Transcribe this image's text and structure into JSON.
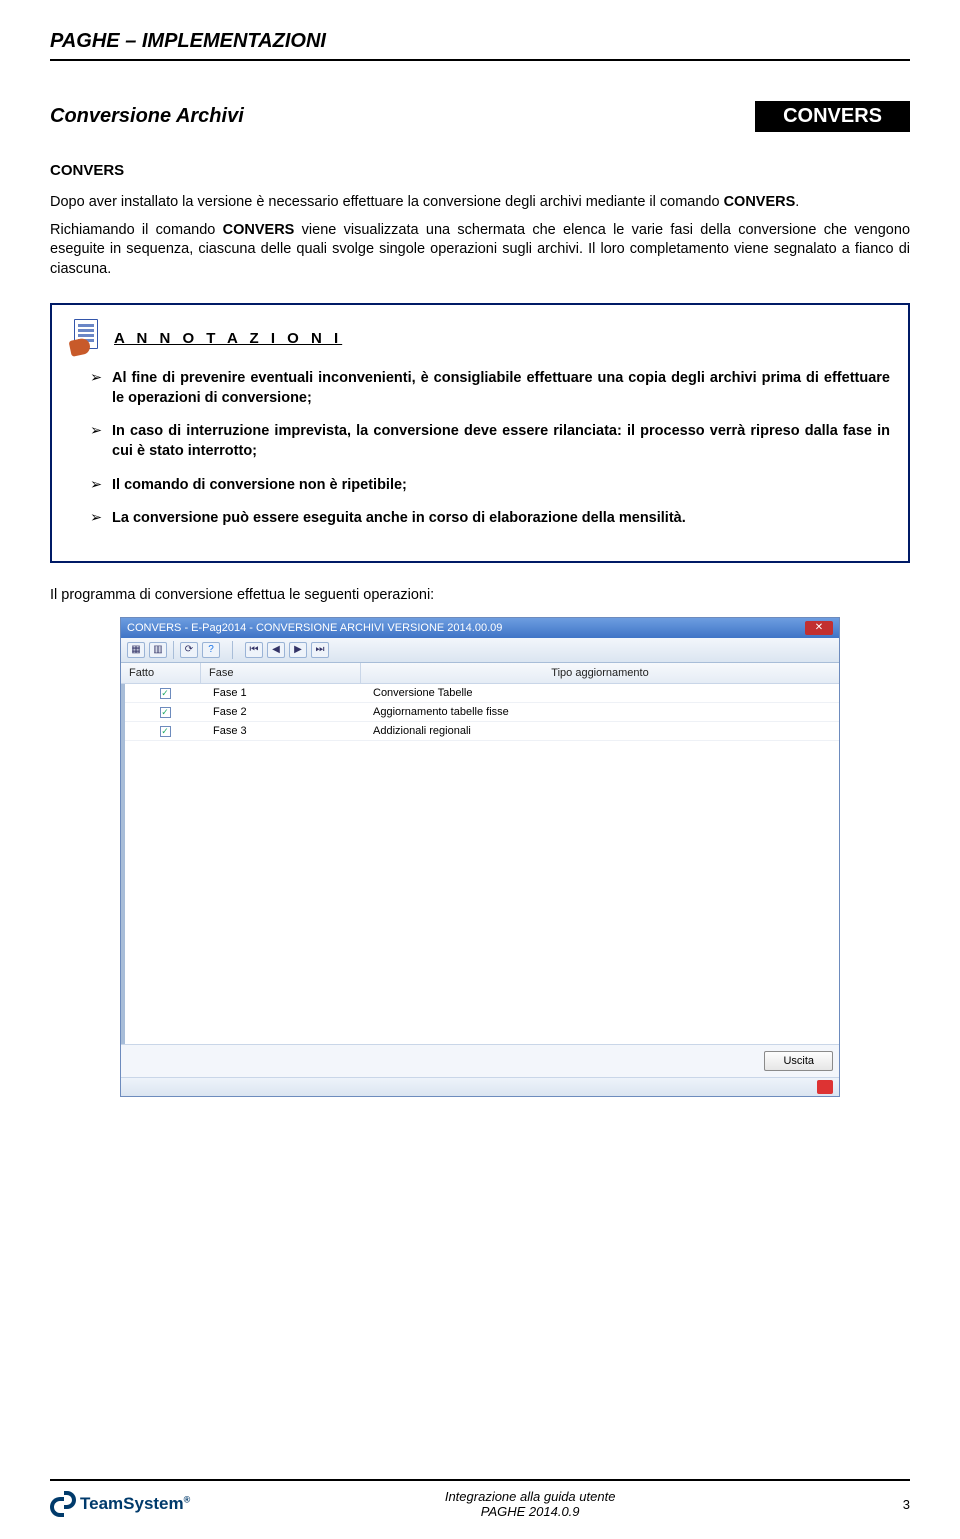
{
  "header": {
    "title": "PAGHE – IMPLEMENTAZIONI"
  },
  "section": {
    "title": "Conversione Archivi",
    "tag": "CONVERS",
    "subhead": "CONVERS"
  },
  "para1_pre": "Dopo aver installato la versione è necessario effettuare la conversione degli archivi mediante il comando ",
  "para1_bold": "CONVERS",
  "para1_post": ".",
  "para2_a": "Richiamando il comando ",
  "para2_bold": "CONVERS",
  "para2_b": " viene visualizzata una schermata che elenca le varie fasi della conversione che vengono eseguite in sequenza, ciascuna delle quali svolge singole operazioni sugli archivi. Il loro completamento viene segnalato a fianco di ciascuna.",
  "annot": {
    "title": "A N N O T A Z I O N I",
    "items": [
      "Al fine di prevenire eventuali inconvenienti, è consigliabile effettuare una copia degli archivi prima di effettuare le operazioni di conversione;",
      "In caso di interruzione imprevista, la conversione deve essere rilanciata: il processo verrà ripreso dalla fase in cui è stato interrotto;",
      "Il comando di conversione non è ripetibile;",
      "La conversione può essere eseguita anche in corso di elaborazione della mensilità."
    ]
  },
  "intro_after": "Il programma di conversione effettua le seguenti operazioni:",
  "app": {
    "title": "CONVERS  -  E-Pag2014  -  CONVERSIONE ARCHIVI VERSIONE 2014.00.09",
    "columns": {
      "c1": "Fatto",
      "c2": "Fase",
      "c3": "Tipo aggiornamento"
    },
    "rows": [
      {
        "fase": "Fase  1",
        "desc": "Conversione Tabelle"
      },
      {
        "fase": "Fase  2",
        "desc": "Aggiornamento tabelle fisse"
      },
      {
        "fase": "Fase  3",
        "desc": "Addizionali regionali"
      }
    ],
    "exit": "Uscita"
  },
  "footer": {
    "brand": "TeamSystem",
    "line1": "Integrazione alla guida utente",
    "line2": "PAGHE 2014.0.9",
    "page": "3"
  }
}
